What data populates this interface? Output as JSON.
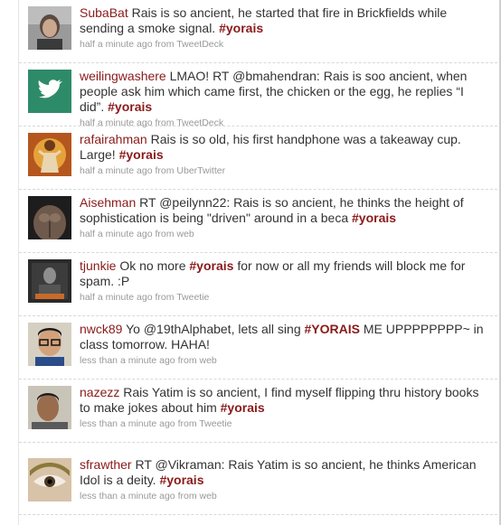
{
  "colors": {
    "username": "#8a1a1a",
    "hashtag": "#8a1a1a",
    "text": "#333333",
    "meta": "#999999"
  },
  "tweets": [
    {
      "user": "SubaBat",
      "text": "Rais is so ancient, he started that fire in Brickfields while sending a smoke signal.",
      "tag": "#yorais",
      "time": "half a minute ago",
      "source": "from TweetDeck",
      "avatar": "portrait-avatar"
    },
    {
      "user": "weilingwashere",
      "text": "LMAO! RT @bmahendran: Rais is soo ancient, when people ask him which came first, the chicken or the egg, he replies “I did”.",
      "tag": "#yorais",
      "time": "half a minute ago",
      "source": "from TweetDeck",
      "avatar": "bird-avatar"
    },
    {
      "user": "rafairahman",
      "text": "Rais is so old, his first handphone was a takeaway cup. Large!",
      "tag": "#yorais",
      "time": "half a minute ago",
      "source": "from UberTwitter",
      "avatar": "figure-avatar"
    },
    {
      "user": "Aisehman",
      "text": "RT @peilynn22: Rais is so ancient, he thinks the height of sophistication is being \"driven\" around in a beca",
      "tag": "#yorais",
      "time": "half a minute ago",
      "source": "from web",
      "avatar": "torso-avatar"
    },
    {
      "user": "tjunkie",
      "text": "Ok no more",
      "tag": "#yorais",
      "text2": "for now or all my friends will block me for spam. :P",
      "time": "half a minute ago",
      "source": "from Tweetie",
      "avatar": "book-avatar"
    },
    {
      "user": "nwck89",
      "text": "Yo @19thAlphabet, lets all sing",
      "tag": "#YORAIS",
      "text2": "ME UPPPPPPPP~ in class tomorrow. HAHA!",
      "time": "less than a minute ago",
      "source": "from web",
      "avatar": "glasses-avatar"
    },
    {
      "user": "nazezz",
      "text": "Rais Yatim is so ancient, I find myself flipping thru history books to make jokes about him",
      "tag": "#yorais",
      "time": "less than a minute ago",
      "source": "from Tweetie",
      "avatar": "face-avatar"
    },
    {
      "user": "sfrawther",
      "text": "RT @Vikraman: Rais Yatim is so ancient, he thinks American Idol is a deity.",
      "tag": "#yorais",
      "time": "less than a minute ago",
      "source": "from web",
      "avatar": "eye-avatar"
    }
  ]
}
